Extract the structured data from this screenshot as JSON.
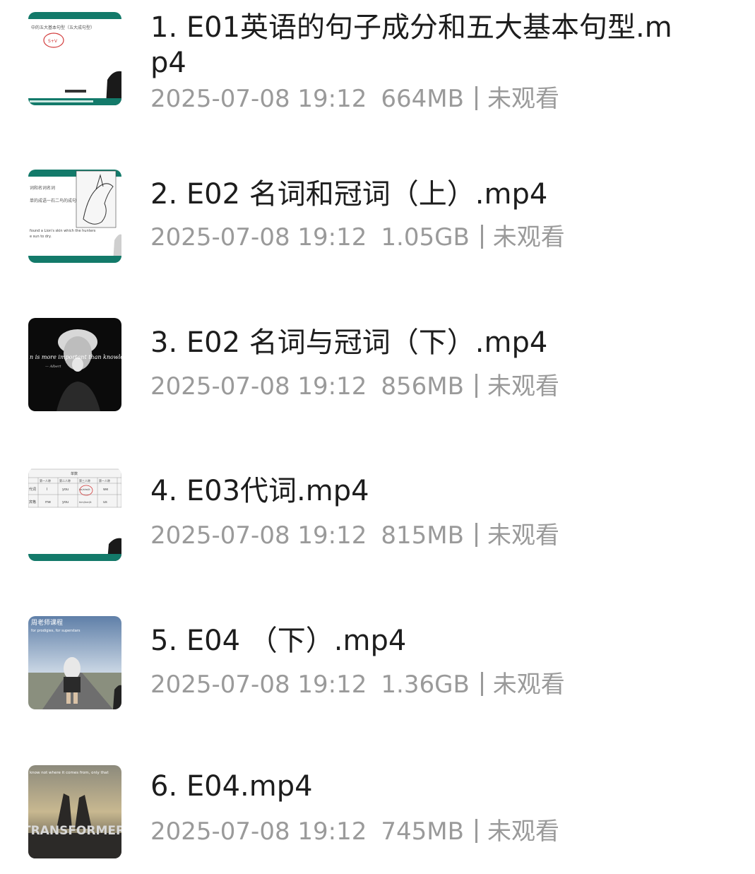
{
  "files": [
    {
      "title": "1. E01英语的句子成分和五大基本句型.mp4",
      "date": "2025-07-08 19:12",
      "size": "664MB",
      "status": "未观看",
      "thumbnail": "lecture-slide"
    },
    {
      "title": "2. E02 名词和冠词（上）.mp4",
      "date": "2025-07-08 19:12",
      "size": "1.05GB",
      "status": "未观看",
      "thumbnail": "lecture-slide-illustration"
    },
    {
      "title": "3. E02 名词与冠词（下）.mp4",
      "date": "2025-07-08 19:12",
      "size": "856MB",
      "status": "未观看",
      "thumbnail": "einstein-quote"
    },
    {
      "title": "4. E03代词.mp4",
      "date": "2025-07-08 19:12",
      "size": "815MB",
      "status": "未观看",
      "thumbnail": "pronoun-table"
    },
    {
      "title": "5. E04 （下）.mp4",
      "date": "2025-07-08 19:12",
      "size": "1.36GB",
      "status": "未观看",
      "thumbnail": "road-scene"
    },
    {
      "title": "6. E04.mp4",
      "date": "2025-07-08 19:12",
      "size": "745MB",
      "status": "未观看",
      "thumbnail": "movie-poster"
    }
  ],
  "thumb_text": {
    "t1_slide": "中的五大基本句型（五大成句型）",
    "t1_circle": "S+V",
    "t2_line1": "词和名词名词",
    "t2_line2": "单的成语一石二鸟的成句",
    "t2_line3": "found a Lion's skin which the hunters",
    "t2_line4": "e sun to dry.",
    "t3_quote": "n is more important than knowledge",
    "t3_author": "— Albert",
    "t4_header": "单数",
    "t4_cols": [
      "第一人称",
      "第二人称",
      "第三人称",
      "第一人称"
    ],
    "t4_row1": [
      "代词",
      "I",
      "you",
      "he/she/it",
      "we"
    ],
    "t4_row2": [
      "宾格",
      "me",
      "you",
      "him/her/it",
      "us"
    ],
    "t5_top": "周老师课程",
    "t5_line": "for prodigies, for superstars",
    "t6_top": "know not where it comes from, only that",
    "t6_logo": "TRANSFORMERS"
  }
}
